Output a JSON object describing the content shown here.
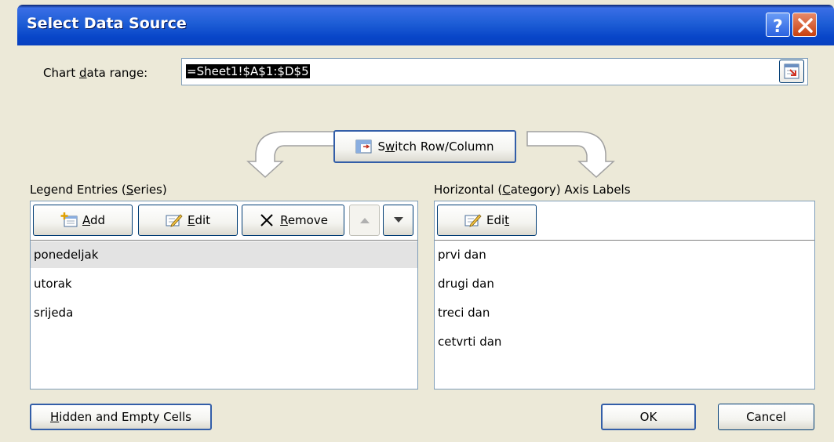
{
  "window": {
    "title": "Select Data Source"
  },
  "range": {
    "label_pre": "Chart ",
    "label_accel": "d",
    "label_post": "ata range:",
    "value": "=Sheet1!$A$1:$D$5"
  },
  "switch_button": {
    "accel": "w",
    "pre": "S",
    "post": "itch Row/Column"
  },
  "legend": {
    "label_pre": "Legend Entries (",
    "label_accel": "S",
    "label_post": "eries)",
    "add": {
      "accel": "A",
      "post": "dd"
    },
    "edit": {
      "accel": "E",
      "post": "dit"
    },
    "remove": {
      "accel": "R",
      "post": "emove"
    },
    "items": [
      "ponedeljak",
      "utorak",
      "srijeda"
    ]
  },
  "axis": {
    "label_pre": "Horizontal (",
    "label_accel": "C",
    "label_post": "ategory) Axis Labels",
    "edit": {
      "pre": "Edi",
      "accel": "t"
    },
    "items": [
      "prvi dan",
      "drugi dan",
      "treci dan",
      "cetvrti dan"
    ]
  },
  "footer": {
    "hidden": {
      "accel": "H",
      "post": "idden and Empty Cells"
    },
    "ok": "OK",
    "cancel": "Cancel"
  }
}
